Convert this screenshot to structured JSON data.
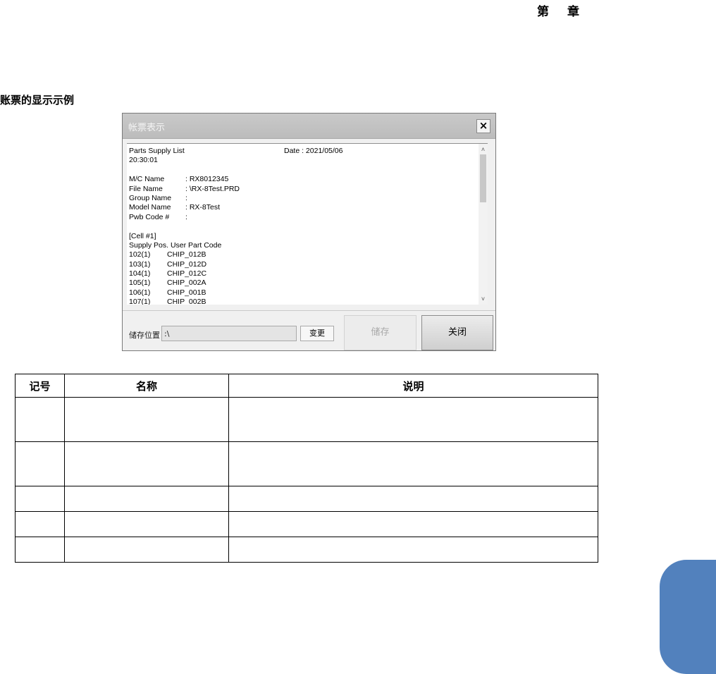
{
  "header": {
    "chapter_left": "第",
    "chapter_right": "章"
  },
  "section": {
    "title": "账票的显示示例"
  },
  "dialog": {
    "title": "帐票表示",
    "close_glyph": "×",
    "report": {
      "title": "Parts Supply List",
      "date_label": "Date : 2021/05/06",
      "time": "20:30:01",
      "fields": [
        {
          "label": "M/C Name",
          "value": ": RX8012345"
        },
        {
          "label": "File Name",
          "value": ": \\RX-8Test.PRD"
        },
        {
          "label": "Group Name",
          "value": ":"
        },
        {
          "label": "Model Name",
          "value": ": RX-8Test"
        },
        {
          "label": "Pwb Code #",
          "value": ":"
        }
      ],
      "cell_header": "[Cell #1]",
      "columns_header": "Supply Pos.  User Part Code",
      "rows": [
        {
          "pos": "102(1)",
          "code": "CHIP_012B"
        },
        {
          "pos": "103(1)",
          "code": "CHIP_012D"
        },
        {
          "pos": "104(1)",
          "code": "CHIP_012C"
        },
        {
          "pos": "105(1)",
          "code": "CHIP_002A"
        },
        {
          "pos": "106(1)",
          "code": "CHIP_001B"
        },
        {
          "pos": "107(1)",
          "code": "CHIP_002B"
        }
      ]
    },
    "scroll_up": "˄",
    "scroll_down": "˅",
    "save_location_label": "储存位置",
    "save_location_value": ":\\",
    "change_button": "变更",
    "save_button": "储存",
    "close_button": "关闭"
  },
  "legend_table": {
    "headers": [
      "记号",
      "名称",
      "说明"
    ],
    "rows": [
      [
        "",
        "",
        ""
      ],
      [
        "",
        "",
        ""
      ],
      [
        "",
        "",
        ""
      ],
      [
        "",
        "",
        ""
      ],
      [
        "",
        "",
        ""
      ]
    ]
  },
  "colors": {
    "side_tab": "#5281bd"
  }
}
